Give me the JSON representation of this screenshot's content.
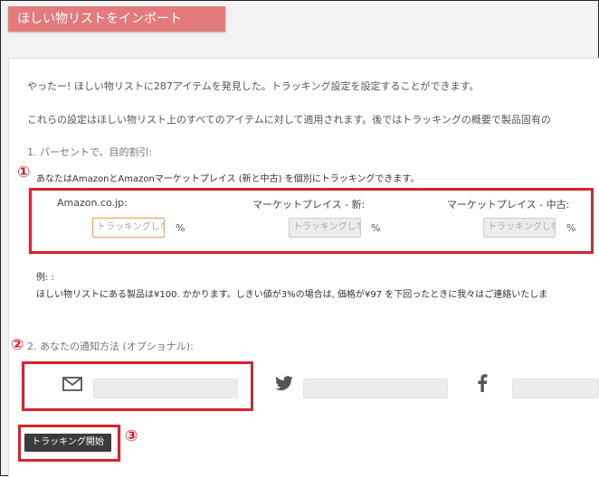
{
  "header": {
    "title": "ほしい物リストをインポート"
  },
  "intro": {
    "found_text": "やったー! ほしい物リストに287アイテムを発見した。トラッキング設定を設定することができます。",
    "apply_text": "これらの設定はほしい物リスト上のすべてのアイテムに対して適用されます。後ではトラッキングの概要で製品固有の"
  },
  "section1": {
    "heading": "1. パーセントで、目的割引:",
    "note": "あなたはAmazonとAmazonマーケットプレイス (新と中古) を個別にトラッキングできます。",
    "fields": [
      {
        "label": "Amazon.co.jp:",
        "placeholder": "トラッキングしない",
        "unit": "%"
      },
      {
        "label": "マーケットプレイス - 新:",
        "placeholder": "トラッキングしない",
        "unit": "%"
      },
      {
        "label": "マーケットプレイス - 中古:",
        "placeholder": "トラッキングしない",
        "unit": "%"
      }
    ]
  },
  "example": {
    "title": "例: :",
    "body": "ほしい物リストにある製品は¥100. かかります。しきい値が3%の場合は, 価格が¥97 を下回ったときに我々はご連絡いたしま"
  },
  "section2": {
    "heading": "2. あなたの通知方法 (オプショナル):",
    "channels": [
      {
        "icon": "email-icon"
      },
      {
        "icon": "twitter-icon"
      },
      {
        "icon": "facebook-icon"
      }
    ]
  },
  "actions": {
    "start_tracking": "トラッキング開始"
  },
  "annotations": {
    "mark1": "①",
    "mark2": "②",
    "mark3": "③"
  },
  "colors": {
    "banner": "#e37a7c",
    "annotation_red": "#d9232e",
    "button": "#3b3b3b",
    "focus": "#f0a46c"
  }
}
